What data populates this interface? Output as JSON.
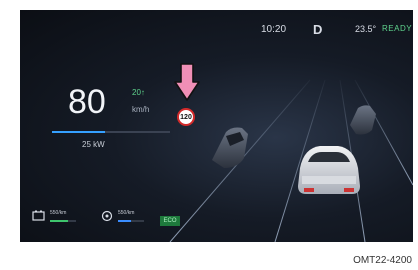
{
  "status_bar": {
    "time": "10:20",
    "gear": "D",
    "temperature": "23.5°",
    "ready_label": "READY"
  },
  "speedometer": {
    "speed": "80",
    "delta": "20↑",
    "unit": "km/h",
    "bar_fraction": 0.45
  },
  "power": {
    "label": "25 kW"
  },
  "speed_sign": {
    "limit": "120",
    "arrow_color": "#f08fb6"
  },
  "bottom_bar": {
    "battery": {
      "value": "550/km",
      "fraction": 0.7,
      "color": "#3ec46d"
    },
    "range": {
      "value": "550/km",
      "fraction": 0.5,
      "color": "#3a8dff"
    },
    "mode_badge": "ECO"
  },
  "caption": "OMT22-4200"
}
